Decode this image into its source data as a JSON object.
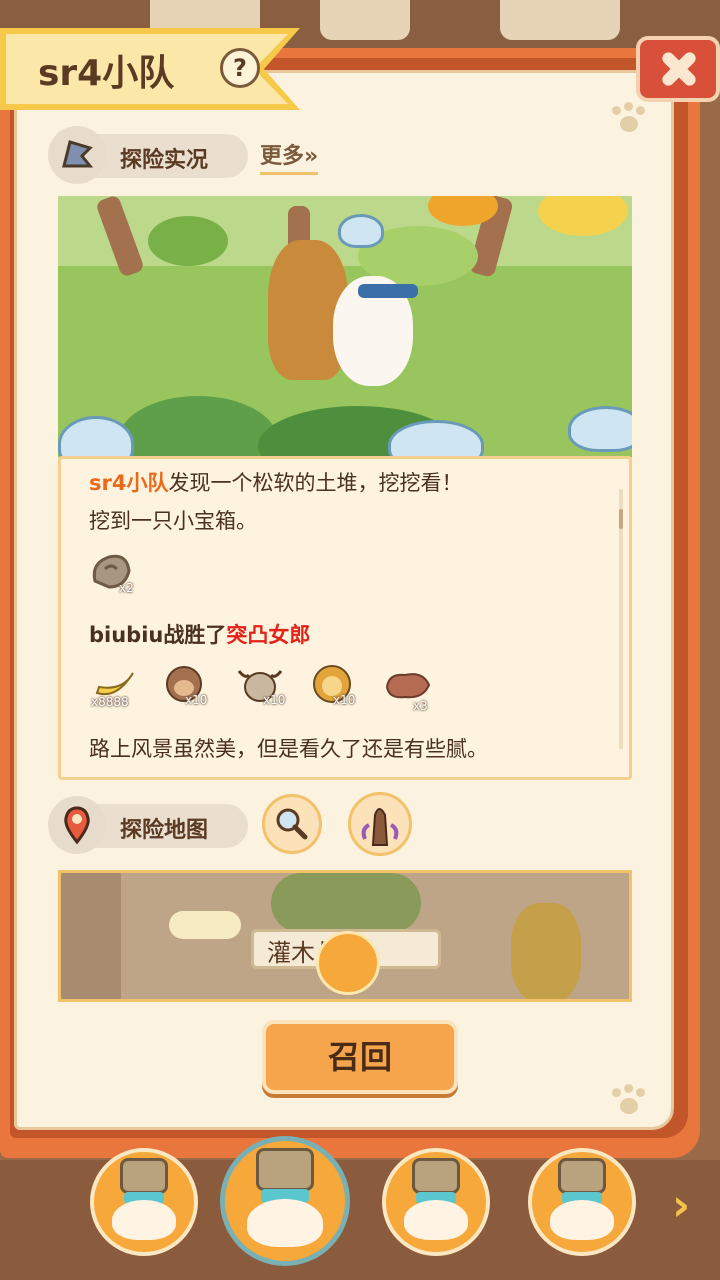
{
  "header": {
    "title": "sr4小队",
    "help_label": "?"
  },
  "report_section": {
    "label": "探险实况",
    "more_label": "更多»"
  },
  "log": {
    "entry1_team": "sr4小队",
    "entry1_text": "发现一个松软的土堆，挖挖看！",
    "entry2_text": "挖到一只小宝箱。",
    "entry2_item_qty": "x2",
    "battle_prefix": "biubiu战胜了",
    "battle_enemy": "突凸女郎",
    "rewards": [
      {
        "icon": "banana-icon",
        "qty": "x8888"
      },
      {
        "icon": "monkey-token-icon",
        "qty": "x10"
      },
      {
        "icon": "bull-token-icon",
        "qty": "x10"
      },
      {
        "icon": "lion-token-icon",
        "qty": "x10"
      },
      {
        "icon": "meat-icon",
        "qty": "x3"
      }
    ],
    "closing_text": "路上风景虽然美，但是看久了还是有些腻。"
  },
  "map_section": {
    "label": "探险地图",
    "location_sign": "灌木丛地"
  },
  "actions": {
    "recall_label": "召回"
  },
  "colors": {
    "accent_orange": "#ea6a1c",
    "enemy_red": "#e2231a",
    "book_orange": "#e9763d"
  }
}
